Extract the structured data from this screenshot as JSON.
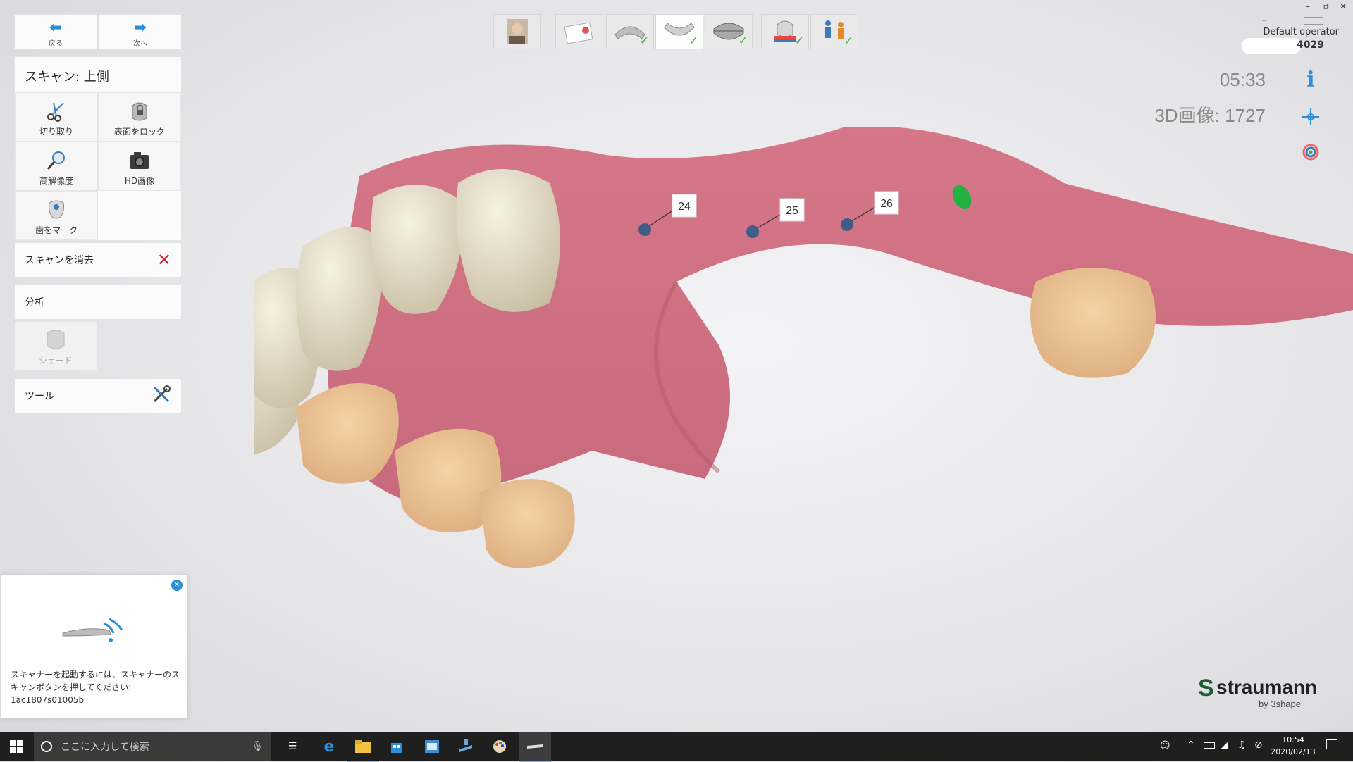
{
  "nav": {
    "back_label": "戻る",
    "next_label": "次へ"
  },
  "scan_panel": {
    "title": "スキャン: 上側",
    "tools": [
      {
        "label": "切り取り",
        "icon": "scissors-icon"
      },
      {
        "label": "表面をロック",
        "icon": "lock-surface-icon"
      },
      {
        "label": "高解像度",
        "icon": "magnifier-icon"
      },
      {
        "label": "HD画像",
        "icon": "camera-icon"
      },
      {
        "label": "歯をマーク",
        "icon": "tooth-mark-icon"
      }
    ]
  },
  "clear_scan": {
    "label": "スキャンを消去"
  },
  "analysis": {
    "label": "分析",
    "shade_label": "シェード"
  },
  "tools_section": {
    "label": "ツール"
  },
  "status": {
    "operator": "Default operator",
    "id_suffix": "4029",
    "timer": "05:33",
    "image_count": "3D画像: 1727"
  },
  "markers": [
    {
      "label": "24"
    },
    {
      "label": "25"
    },
    {
      "label": "26"
    }
  ],
  "scanner_popup": {
    "message": "スキャナーを起動するには、スキャナーのスキャンボタンを押してください:",
    "device_id": "1ac1807s01005b"
  },
  "brand": {
    "name": "straumann",
    "sub": "by 3shape"
  },
  "taskbar": {
    "search_placeholder": "ここに入力して検索",
    "time": "10:54",
    "date": "2020/02/13"
  },
  "colors": {
    "accent": "#2a8fd6",
    "check": "#3bb03b",
    "clear": "#c0263a"
  }
}
